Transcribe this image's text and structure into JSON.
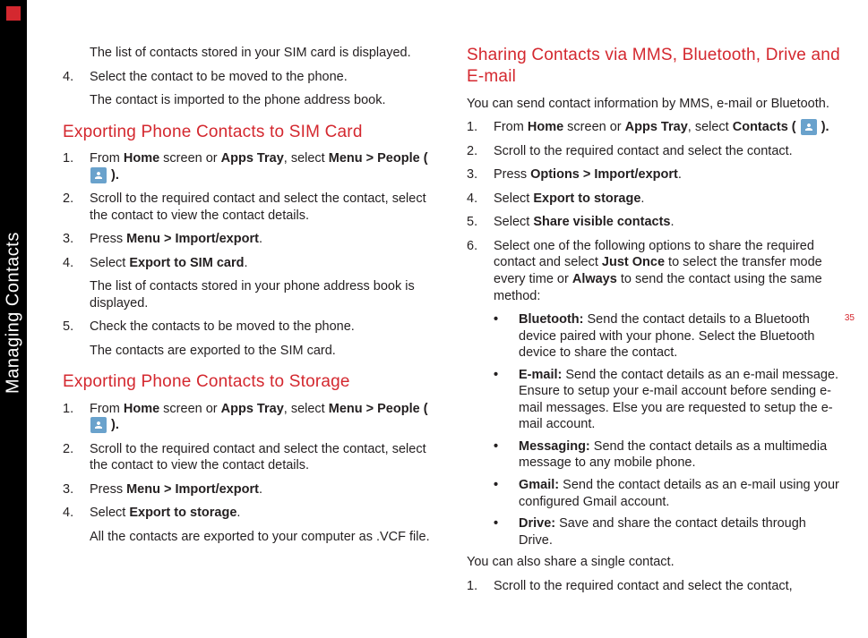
{
  "sidebar_label": "Managing Contacts",
  "page_number": "35",
  "left": {
    "p1": "The list of contacts stored in your SIM card is displayed.",
    "step4": "Select the contact to be moved to the phone.",
    "p2": "The contact is imported to the phone address book.",
    "h1": "Exporting Phone Contacts to SIM Card",
    "s1_pre": "From ",
    "s1_b1": "Home",
    "s1_mid1": " screen or ",
    "s1_b2": "Apps Tray",
    "s1_mid2": ", select ",
    "s1_b3": "Menu > People (",
    "s1_post": " ).",
    "s2": "Scroll to the required contact and select the contact, select the contact to view the contact details.",
    "s3_pre": "Press ",
    "s3_b": "Menu > Import/export",
    "s3_post": ".",
    "s4_pre": "Select ",
    "s4_b": "Export to SIM card",
    "s4_post": ".",
    "p3": "The list of contacts stored in your phone address book is displayed.",
    "s5": "Check the contacts to be moved to the phone.",
    "p4": "The contacts are exported to the SIM card.",
    "h2": "Exporting Phone Contacts to Storage",
    "t1_pre": "From ",
    "t1_b1": "Home",
    "t1_mid1": " screen or ",
    "t1_b2": "Apps Tray",
    "t1_mid2": ", select ",
    "t1_b3": "Menu > People (",
    "t1_post": " ).",
    "t2": "Scroll to the required contact and select the contact, select the contact to view the contact details.",
    "t3_pre": "Press ",
    "t3_b": "Menu > Import/export",
    "t3_post": ".",
    "t4_pre": "Select ",
    "t4_b": "Export to storage",
    "t4_post": ".",
    "p5": "All the contacts are exported to your computer as .VCF file."
  },
  "right": {
    "h1": "Sharing Contacts via MMS, Bluetooth, Drive and E-mail",
    "p1": "You can send contact information by MMS, e-mail or Bluetooth.",
    "s1_pre": "From ",
    "s1_b1": "Home",
    "s1_mid1": " screen or ",
    "s1_b2": "Apps Tray",
    "s1_mid2": ", select ",
    "s1_b3": "Contacts (",
    "s1_post": " ).",
    "s2": "Scroll to the required contact and select the contact.",
    "s3_pre": "Press ",
    "s3_b": "Options > Import/export",
    "s3_post": ".",
    "s4_pre": "Select ",
    "s4_b": "Export to storage",
    "s4_post": ".",
    "s5_pre": "Select ",
    "s5_b": "Share visible contacts",
    "s5_post": ".",
    "s6_pre": "Select one of the following options to share the required contact and select ",
    "s6_b1": "Just Once",
    "s6_mid": " to select the transfer mode every time or ",
    "s6_b2": "Always",
    "s6_post": " to send the contact using the same method:",
    "b1_label": "Bluetooth:",
    "b1_txt": " Send the contact details to a Bluetooth device paired with your phone. Select the Bluetooth device to share the contact.",
    "b2_label": "E-mail:",
    "b2_txt": " Send the contact details as an e-mail message. Ensure to setup your e-mail account before sending e-mail messages. Else you are requested to setup the e-mail account.",
    "b3_label": "Messaging:",
    "b3_txt": " Send the contact details as a multimedia message to any mobile phone.",
    "b4_label": "Gmail:",
    "b4_txt": " Send the contact details as an e-mail using your configured Gmail account.",
    "b5_label": "Drive:",
    "b5_txt": "  Save and share the contact details through Drive.",
    "p2": "You can also share a single contact.",
    "u1": "Scroll to the required contact and select the contact,"
  },
  "num": {
    "n1": "1.",
    "n2": "2.",
    "n3": "3.",
    "n4": "4.",
    "n5": "5.",
    "n6": "6."
  },
  "bullet": "•"
}
